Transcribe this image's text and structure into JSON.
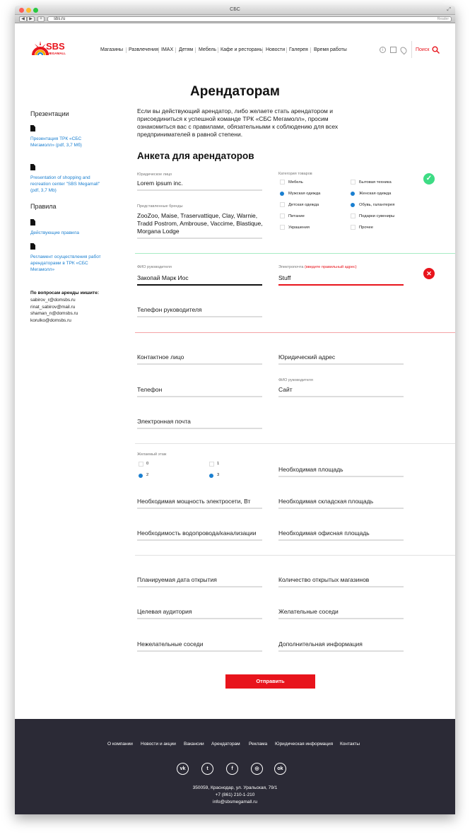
{
  "window": {
    "title": "СБС",
    "url": "sbs.ru",
    "reader": "Reader"
  },
  "logo": {
    "text": "SBS",
    "sub": "MEGAMALL"
  },
  "nav": [
    "Магазины",
    "Развлечения",
    "IMAX",
    "Детям",
    "Мебель",
    "Кафе и рестораны",
    "Новости",
    "Галерея",
    "Время работы"
  ],
  "search_label": "Поиск",
  "page_title": "Арендаторам",
  "sidebar": {
    "presentations_title": "Презентации",
    "presentations": [
      "Презентация ТРК «СБС Мегамолл» (pdf, 3,7 Мб)",
      "Presentation of shopping and recreation center \"SBS Megamall\" (pdf, 3,7 Mb)"
    ],
    "rules_title": "Правила",
    "rules": [
      "Действующие правила",
      "Регламент осуществления работ арендаторами в ТРК «СБС Мегамолл»"
    ],
    "contact_title": "По вопросам аренды иишите:",
    "emails": [
      "sabirov_r@domsbs.ru",
      "rinat_sabirov@mail.ru",
      "shaman_n@domsbs.ru",
      "korulko@domsbs.ru"
    ]
  },
  "intro": "Если вы действующий арендатор, либо желаете стать арендатором и присоединиться к успешной команде ТРК «СБС Мегамолл», просим ознакомиться вас с правилами, обязательными к соблюдению для всех предпринимателей в равной степени.",
  "form_title": "Анкета для арендаторов",
  "legal_label": "Юридическое лицо",
  "legal_value": "Lorem ipsum inc.",
  "brands_label": "Представленные бренды",
  "brands_value": "ZooZoo, Maise, Traservattique, Clay, Warnie, Tradd Postrom, Ambrouse, Vaccime, Blastique, Morgana Lodge",
  "categories_label": "Категория товаров",
  "categories": [
    {
      "label": "Мебель",
      "checked": false
    },
    {
      "label": "Бытовая техника",
      "checked": false
    },
    {
      "label": "Мужская одежда",
      "checked": true
    },
    {
      "label": "Женская одежда",
      "checked": true
    },
    {
      "label": "Детская одежда",
      "checked": false
    },
    {
      "label": "Обувь, галантерея",
      "checked": true
    },
    {
      "label": "Питание",
      "checked": false
    },
    {
      "label": "Подарки сувениры",
      "checked": false
    },
    {
      "label": "Украшения",
      "checked": false
    },
    {
      "label": "Прочее",
      "checked": false
    }
  ],
  "director_label": "ФИО руководителя",
  "director_value": "Закопай Марк Иос",
  "email_label": "Электропочта",
  "email_error": "(введите правильный адрес)",
  "email_value": "Stuff",
  "director_phone": "Телефон руководителя",
  "contact_person": "Контактное лицо",
  "legal_address": "Юридический адрес",
  "phone": "Телефон",
  "site_label": "ФИО руководителя",
  "site": "Сайт",
  "email_field": "Электронная почта",
  "floor_label": "Желаемый этаж",
  "floors": [
    {
      "label": "0",
      "checked": false
    },
    {
      "label": "1",
      "checked": false
    },
    {
      "label": "2",
      "checked": true
    },
    {
      "label": "3",
      "checked": true
    }
  ],
  "area": "Необходимая площадь",
  "power": "Необходимая мощность электросети, Вт",
  "storage": "Необходимая складская площадь",
  "water": "Необходимость водопровода/канализации",
  "office": "Необходимая офисная площадь",
  "open_date": "Планируемая дата открытия",
  "stores_count": "Количество открытых магазинов",
  "audience": "Целевая аудитория",
  "wanted_neighbors": "Желательные соседи",
  "unwanted_neighbors": "Нежелательные соседи",
  "additional": "Дополнительная информация",
  "submit": "Отправить",
  "footer": {
    "links": [
      "О компании",
      "Новости и акции",
      "Вакансии",
      "Арендаторам",
      "Реклама",
      "Юридическая информация",
      "Контакты"
    ],
    "social": [
      "vk",
      "tw",
      "f",
      "ig",
      "ok"
    ],
    "address": "350059, Краснодар, ул. Уральская, 79/1",
    "phone": "+7 (861) 210-1-210",
    "email": "info@sbsmegamall.ru"
  },
  "colors": {
    "accent": "#e8141c",
    "link": "#1a7fd0",
    "success": "#3ddc84",
    "error": "#e8141c",
    "footer": "#2b2a36"
  }
}
